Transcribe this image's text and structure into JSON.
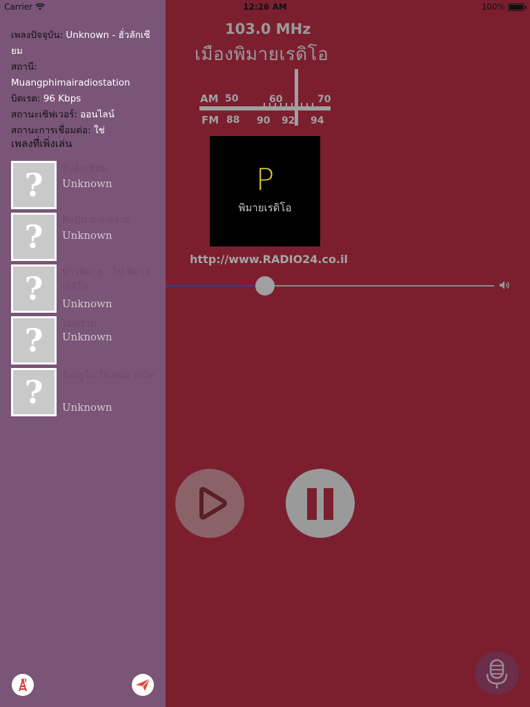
{
  "status": {
    "carrier": "Carrier",
    "time": "12:26 AM",
    "battery": "100%"
  },
  "sidebar": {
    "info": [
      {
        "label": "เพลงปัจจุบัน: ",
        "value": "Unknown - ฮั่วลักเซียม"
      },
      {
        "label": "สถานี: ",
        "value": "Muangphimairadiostation"
      },
      {
        "label": "บิตเรต: ",
        "value": "96 Kbps"
      },
      {
        "label": "สถานะเซิฟเวอร์: ",
        "value": "ออนไลน์"
      },
      {
        "label": "สถานะการเชื่อมต่อ: ",
        "value": "ใช่"
      }
    ],
    "recent_title": "เพลงที่เพิ่งเล่น",
    "recent": [
      {
        "title": "ฮั่วลักเซียม",
        "artist": "Unknown"
      },
      {
        "title": "ศิลปิน ฮากหลาย",
        "artist": "Unknown"
      },
      {
        "title": "บ่าวพิมาย - โบ พิมายเรดิโอ",
        "artist": "Unknown"
      },
      {
        "title": "ไม่ทราบ",
        "artist": "Unknown"
      },
      {
        "title": "ยังอยู่ใน ใจเสมอ เดวิด",
        "artist": "Unknown"
      }
    ],
    "thumb_glyph": "?"
  },
  "player": {
    "frequency": "103.0 MHz",
    "station_name": "เมืองพิมายเรดิโอ",
    "dial": {
      "am_label": "AM",
      "fm_label": "FM",
      "am_ticks": [
        "50",
        "60",
        "70"
      ],
      "fm_ticks": [
        "88",
        "90",
        "92",
        "94"
      ]
    },
    "logo_letter": "P",
    "logo_sub": "พิมายเรดิโอ",
    "url": "http://www.RADIO24.co.il",
    "volume": 0.51
  },
  "colors": {
    "main_bg": "#7b1f2f",
    "sidebar_bg": "#7a5578",
    "slider_fill": "#2f3fa0"
  },
  "icons": [
    "wifi-icon",
    "battery-icon",
    "speaker-icon",
    "play-icon",
    "pause-icon",
    "microphone-icon",
    "antenna-icon",
    "paper-plane-icon",
    "question-mark-icon"
  ]
}
